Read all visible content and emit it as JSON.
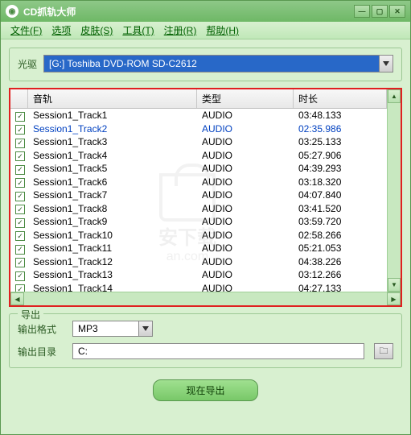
{
  "title": "CD抓轨大师",
  "menu": [
    "文件(F)",
    "选项",
    "皮肤(S)",
    "工具(T)",
    "注册(R)",
    "帮助(H)"
  ],
  "drive": {
    "label": "光驱",
    "value": "[G:] Toshiba  DVD-ROM SD-C2612"
  },
  "columns": {
    "track": "音轨",
    "type": "类型",
    "duration": "时长"
  },
  "tracks": [
    {
      "checked": true,
      "name": "Session1_Track1",
      "type": "AUDIO",
      "duration": "03:48.133",
      "selected": false
    },
    {
      "checked": true,
      "name": "Session1_Track2",
      "type": "AUDIO",
      "duration": "02:35.986",
      "selected": true
    },
    {
      "checked": true,
      "name": "Session1_Track3",
      "type": "AUDIO",
      "duration": "03:25.133",
      "selected": false
    },
    {
      "checked": true,
      "name": "Session1_Track4",
      "type": "AUDIO",
      "duration": "05:27.906",
      "selected": false
    },
    {
      "checked": true,
      "name": "Session1_Track5",
      "type": "AUDIO",
      "duration": "04:39.293",
      "selected": false
    },
    {
      "checked": true,
      "name": "Session1_Track6",
      "type": "AUDIO",
      "duration": "03:18.320",
      "selected": false
    },
    {
      "checked": true,
      "name": "Session1_Track7",
      "type": "AUDIO",
      "duration": "04:07.840",
      "selected": false
    },
    {
      "checked": true,
      "name": "Session1_Track8",
      "type": "AUDIO",
      "duration": "03:41.520",
      "selected": false
    },
    {
      "checked": true,
      "name": "Session1_Track9",
      "type": "AUDIO",
      "duration": "03:59.720",
      "selected": false
    },
    {
      "checked": true,
      "name": "Session1_Track10",
      "type": "AUDIO",
      "duration": "02:58.266",
      "selected": false
    },
    {
      "checked": true,
      "name": "Session1_Track11",
      "type": "AUDIO",
      "duration": "05:21.053",
      "selected": false
    },
    {
      "checked": true,
      "name": "Session1_Track12",
      "type": "AUDIO",
      "duration": "04:38.226",
      "selected": false
    },
    {
      "checked": true,
      "name": "Session1_Track13",
      "type": "AUDIO",
      "duration": "03:12.266",
      "selected": false
    },
    {
      "checked": true,
      "name": "Session1_Track14",
      "type": "AUDIO",
      "duration": "04:27.133",
      "selected": false
    }
  ],
  "export": {
    "legend": "导出",
    "format_label": "输出格式",
    "format_value": "MP3",
    "dir_label": "输出目录",
    "dir_value": "C:",
    "button": "现在导出"
  },
  "watermark": {
    "line1": "安下载",
    "line2": "an.com"
  }
}
